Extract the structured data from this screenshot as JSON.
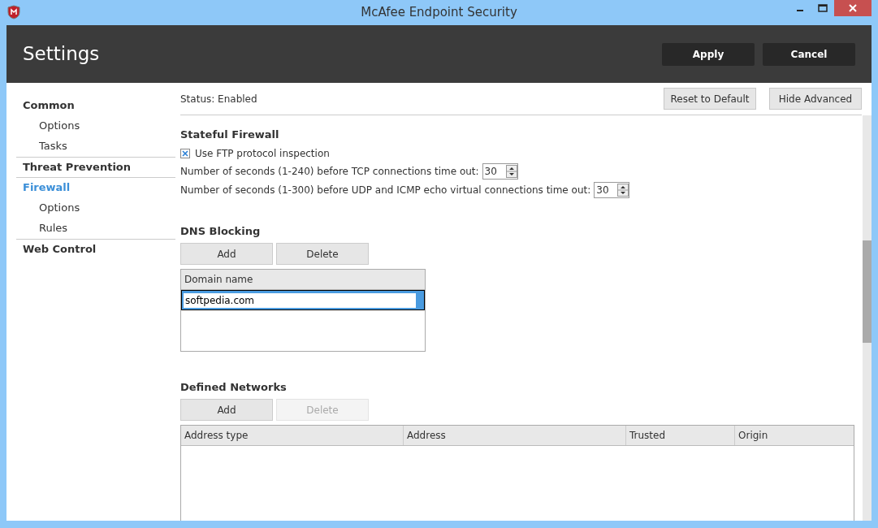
{
  "window": {
    "title": "McAfee Endpoint Security"
  },
  "header": {
    "title": "Settings",
    "buttons": [
      "Apply",
      "Cancel"
    ]
  },
  "sidebar": {
    "items": [
      {
        "label": "Common",
        "selected": false,
        "children": [
          {
            "label": "Options",
            "selected": false
          },
          {
            "label": "Tasks",
            "selected": false
          }
        ]
      },
      {
        "label": "Threat Prevention",
        "selected": false
      },
      {
        "label": "Firewall",
        "selected": true,
        "children": [
          {
            "label": "Options",
            "selected": false
          },
          {
            "label": "Rules",
            "selected": false
          }
        ]
      },
      {
        "label": "Web Control",
        "selected": false
      }
    ]
  },
  "toolbar": {
    "status": "Status: Enabled",
    "buttons": [
      "Reset to Default",
      "Hide Advanced"
    ]
  },
  "stateful_firewall": {
    "title": "Stateful Firewall",
    "ftp_inspection": {
      "label": "Use FTP protocol inspection",
      "checked": true
    },
    "spinners": [
      {
        "label": "Number of seconds (1-240) before TCP connections time out:",
        "value": "30"
      },
      {
        "label": "Number of seconds (1-300) before UDP and ICMP echo virtual connections time out:",
        "value": "30"
      }
    ]
  },
  "dns_blocking": {
    "title": "DNS Blocking",
    "buttons": [
      {
        "label": "Add",
        "disabled": false
      },
      {
        "label": "Delete",
        "disabled": false
      }
    ],
    "columns": [
      "Domain name"
    ],
    "rows": [
      {
        "value": "softpedia.com",
        "selected": true,
        "editing": true
      }
    ]
  },
  "defined_networks": {
    "title": "Defined Networks",
    "buttons": [
      {
        "label": "Add",
        "disabled": false
      },
      {
        "label": "Delete",
        "disabled": true
      }
    ],
    "columns": [
      "Address type",
      "Address",
      "Trusted",
      "Origin"
    ]
  }
}
